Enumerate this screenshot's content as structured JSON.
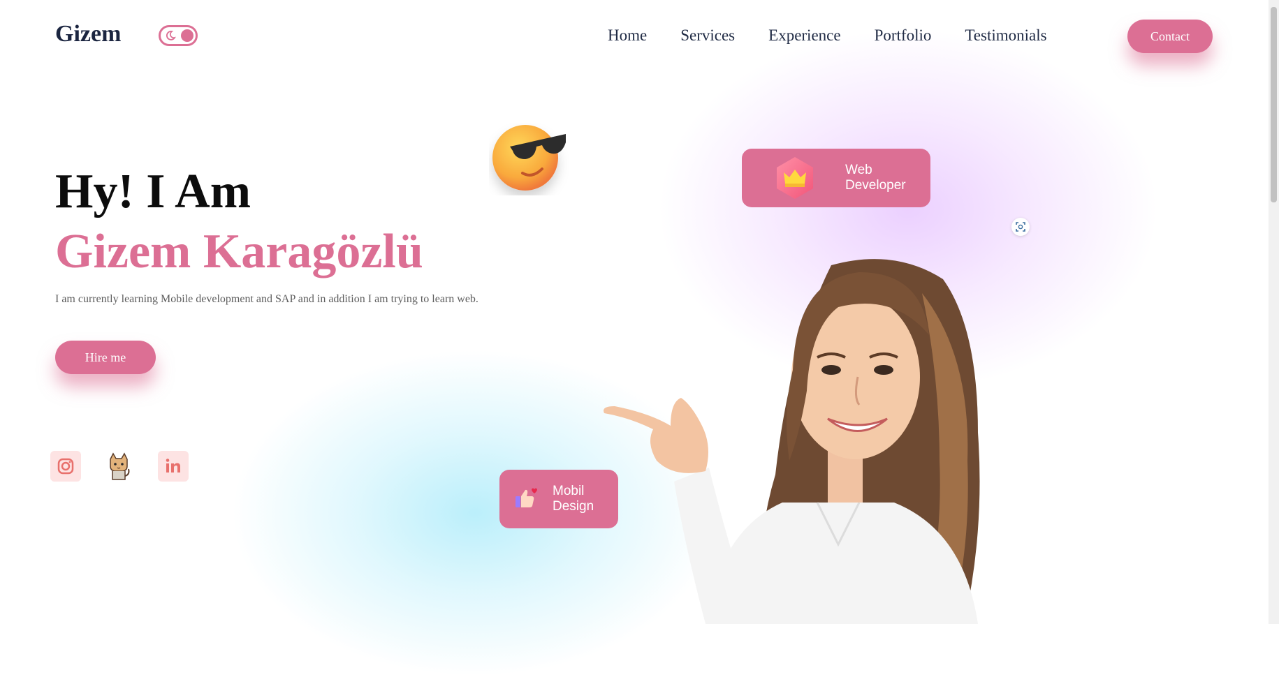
{
  "header": {
    "logo": "Gizem",
    "theme_toggle_icon": "moon-icon",
    "nav": [
      "Home",
      "Services",
      "Experience",
      "Portfolio",
      "Testimonials"
    ],
    "contact_label": "Contact"
  },
  "hero": {
    "greeting": "Hy! I Am",
    "name": "Gizem Karagözlü",
    "bio": "I am currently learning Mobile development and SAP and in addition I am trying to learn web.",
    "hire_label": "Hire me"
  },
  "socials": [
    {
      "icon": "instagram-icon"
    },
    {
      "icon": "cat-icon"
    },
    {
      "icon": "linkedin-icon"
    }
  ],
  "cards": {
    "web_line1": "Web",
    "web_line2": "Developer",
    "mobil_line1": "Mobil",
    "mobil_line2": "Design"
  },
  "colors": {
    "accent": "#dc6f94",
    "text_dark": "#1f2a44",
    "glow_purple": "#e8c8ff",
    "glow_cyan": "#afecfa"
  }
}
